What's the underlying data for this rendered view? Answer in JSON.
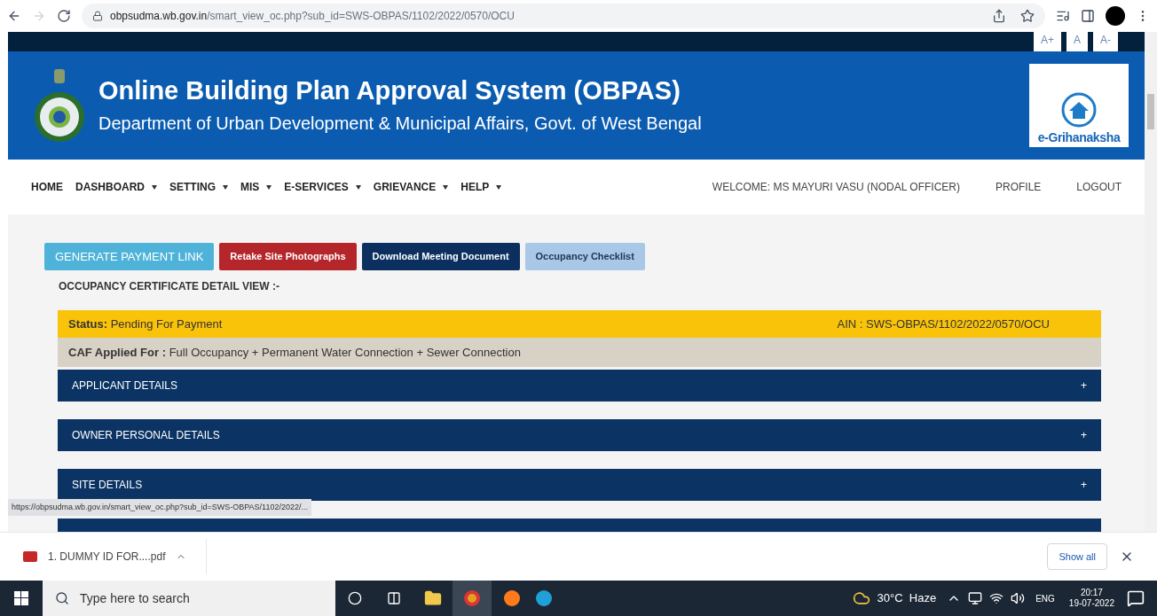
{
  "browser": {
    "url_host": "obpsudma.wb.gov.in",
    "url_path": "/smart_view_oc.php?sub_id=SWS-OBPAS/1102/2022/0570/OCU"
  },
  "font_sizes": [
    "A+",
    "A",
    "A-"
  ],
  "header": {
    "title": "Online Building Plan Approval System (OBPAS)",
    "subtitle": "Department of Urban Development & Municipal Affairs, Govt. of West Bengal",
    "logo_text": "e-Grihanaksha"
  },
  "nav": [
    {
      "label": "HOME",
      "dropdown": false
    },
    {
      "label": "DASHBOARD",
      "dropdown": true
    },
    {
      "label": "SETTING",
      "dropdown": true
    },
    {
      "label": "MIS",
      "dropdown": true
    },
    {
      "label": "E-SERVICES",
      "dropdown": true
    },
    {
      "label": "GRIEVANCE",
      "dropdown": true
    },
    {
      "label": "HELP",
      "dropdown": true
    }
  ],
  "user": {
    "welcome": "WELCOME: MS MAYURI VASU (NODAL OFFICER)",
    "links": [
      "PROFILE",
      "LOGOUT"
    ]
  },
  "actions": [
    {
      "label": "GENERATE PAYMENT LINK",
      "kind": "teal"
    },
    {
      "label": "Retake Site Photographs",
      "kind": "red"
    },
    {
      "label": "Download Meeting Document",
      "kind": "navy"
    },
    {
      "label": "Occupancy Checklist",
      "kind": "light"
    }
  ],
  "section_title": "OCCUPANCY CERTIFICATE DETAIL VIEW :-",
  "status": {
    "label": "Status:",
    "value": "Pending For Payment",
    "ain": "AIN : SWS-OBPAS/1102/2022/0570/OCU"
  },
  "caf": {
    "label": "CAF Applied For :",
    "value": "Full Occupancy + Permanent Water Connection + Sewer Connection"
  },
  "accordions": [
    {
      "title": "APPLICANT DETAILS",
      "toggle": "+"
    },
    {
      "title": "OWNER PERSONAL DETAILS",
      "toggle": "+"
    },
    {
      "title": "SITE DETAILS",
      "toggle": "+"
    }
  ],
  "status_url": "https://obpsudma.wb.gov.in/smart_view_oc.php?sub_id=SWS-OBPAS/1102/2022/...",
  "downloads": {
    "file": "1. DUMMY ID FOR....pdf",
    "show_all": "Show all"
  },
  "taskbar": {
    "search_placeholder": "Type here to search",
    "weather": "30°C  Haze",
    "lang": "ENG",
    "time": "20:17",
    "date": "19-07-2022"
  }
}
